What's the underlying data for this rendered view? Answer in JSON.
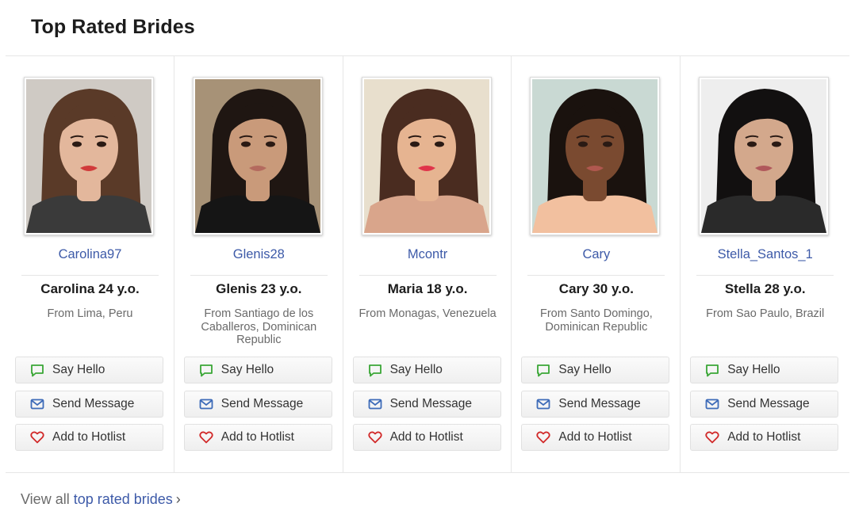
{
  "section": {
    "title": "Top Rated Brides"
  },
  "brides": [
    {
      "username": "Carolina97",
      "name_age": "Carolina 24 y.o.",
      "location": "From Lima, Peru",
      "skin": "#e3b79c",
      "hair": "#5a3a28",
      "bg": "#cfcac4",
      "shirt": "#3a3a3a",
      "lips": "#d13a3a"
    },
    {
      "username": "Glenis28",
      "name_age": "Glenis 23 y.o.",
      "location": "From Santiago de los Caballeros, Dominican Republic",
      "skin": "#c99a7a",
      "hair": "#1f1612",
      "bg": "#a79277",
      "shirt": "#151515",
      "lips": "#b46a5e"
    },
    {
      "username": "Mcontr",
      "name_age": "Maria 18 y.o.",
      "location": "From Monagas, Venezuela",
      "skin": "#e6b491",
      "hair": "#4a2c20",
      "bg": "#e8dfcd",
      "shirt": "#d9a58b",
      "lips": "#e0344a"
    },
    {
      "username": "Cary",
      "name_age": "Cary 30 y.o.",
      "location": "From Santo Domingo, Dominican Republic",
      "skin": "#7a4a30",
      "hair": "#1a120e",
      "bg": "#c9d9d3",
      "shirt": "#f2c09f",
      "lips": "#b0584f"
    },
    {
      "username": "Stella_Santos_1",
      "name_age": "Stella 28 y.o.",
      "location": "From Sao Paulo, Brazil",
      "skin": "#d3a88c",
      "hair": "#121010",
      "bg": "#eeeeee",
      "shirt": "#2a2a2a",
      "lips": "#b0585b"
    }
  ],
  "buttons": {
    "hello": "Say Hello",
    "message": "Send Message",
    "hotlist": "Add to Hotlist"
  },
  "colors": {
    "hello_icon": "#3aa636",
    "message_icon": "#3d6bb8",
    "hotlist_icon": "#d12a2a",
    "link": "#3d5aa8"
  },
  "footer": {
    "prefix": "View all",
    "link": "top rated brides",
    "chevron": "›"
  }
}
